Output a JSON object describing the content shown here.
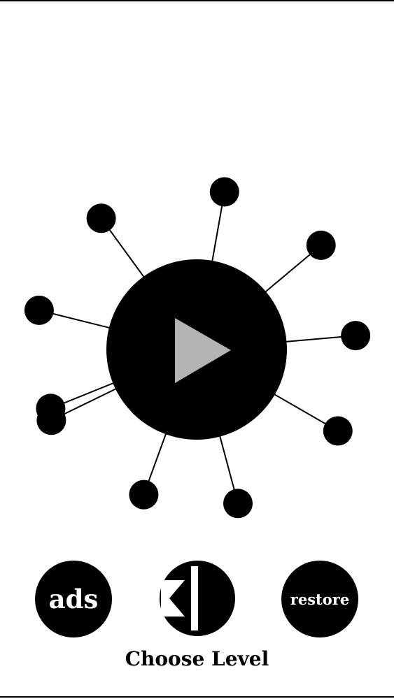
{
  "pins": [
    {
      "angle": -80
    },
    {
      "angle": -40
    },
    {
      "angle": -5
    },
    {
      "angle": 30
    },
    {
      "angle": 75
    },
    {
      "angle": 110
    },
    {
      "angle": 154
    },
    {
      "angle": 194
    },
    {
      "angle": 234
    },
    {
      "angle": 158
    }
  ],
  "buttons": {
    "ads_label": "ads",
    "restore_label": "restore"
  },
  "footer": {
    "choose_level_label": "Choose Level"
  },
  "colors": {
    "foreground": "#000000",
    "background": "#ffffff",
    "play_triangle": "#b3b3b3"
  }
}
